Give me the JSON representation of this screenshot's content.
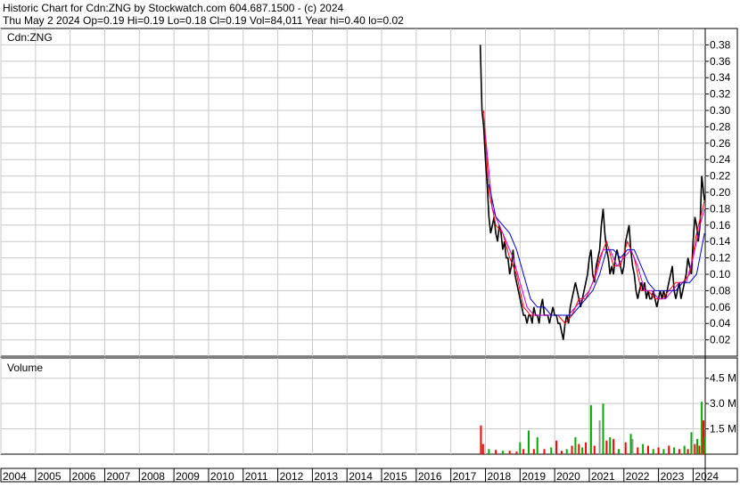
{
  "header": {
    "line1": "Historic Chart for Cdn:ZNG by Stockwatch.com 604.687.1500 - (c) 2024",
    "line2": "Thu May  2 2024  Op=0.19  Hi=0.19  Lo=0.18  Cl=0.19  Vol=84,011  Year hi=0.40  lo=0.02"
  },
  "chart_data": [
    {
      "type": "line",
      "label": "Cdn:ZNG",
      "y_ticks": [
        "0.38",
        "0.36",
        "0.34",
        "0.32",
        "0.30",
        "0.28",
        "0.26",
        "0.24",
        "0.22",
        "0.20",
        "0.18",
        "0.16",
        "0.14",
        "0.12",
        "0.10",
        "0.08",
        "0.06",
        "0.04",
        "0.02"
      ],
      "ylim": [
        0.0,
        0.4
      ],
      "x_ticks": [
        "2004",
        "2005",
        "2006",
        "2007",
        "2008",
        "2009",
        "2010",
        "2011",
        "2012",
        "2013",
        "2014",
        "2015",
        "2016",
        "2017",
        "2018",
        "2019",
        "2020",
        "2021",
        "2022",
        "2023",
        "2024"
      ],
      "xlim": [
        2004.0,
        2024.35
      ],
      "grid": true,
      "series": [
        {
          "key": "price",
          "color": "#000000",
          "x": [
            2017.85,
            2017.9,
            2017.95,
            2018.0,
            2018.05,
            2018.1,
            2018.15,
            2018.2,
            2018.25,
            2018.3,
            2018.35,
            2018.4,
            2018.45,
            2018.5,
            2018.55,
            2018.6,
            2018.65,
            2018.7,
            2018.75,
            2018.8,
            2018.85,
            2018.9,
            2018.95,
            2019.0,
            2019.05,
            2019.1,
            2019.15,
            2019.2,
            2019.25,
            2019.3,
            2019.35,
            2019.4,
            2019.45,
            2019.5,
            2019.55,
            2019.6,
            2019.65,
            2019.7,
            2019.75,
            2019.8,
            2019.85,
            2019.9,
            2019.95,
            2020.0,
            2020.05,
            2020.1,
            2020.15,
            2020.2,
            2020.25,
            2020.3,
            2020.35,
            2020.4,
            2020.45,
            2020.5,
            2020.55,
            2020.6,
            2020.65,
            2020.7,
            2020.75,
            2020.8,
            2020.85,
            2020.9,
            2020.95,
            2021.0,
            2021.05,
            2021.1,
            2021.15,
            2021.2,
            2021.25,
            2021.3,
            2021.35,
            2021.4,
            2021.45,
            2021.5,
            2021.55,
            2021.6,
            2021.65,
            2021.7,
            2021.75,
            2021.8,
            2021.85,
            2021.9,
            2021.95,
            2022.0,
            2022.05,
            2022.1,
            2022.15,
            2022.2,
            2022.25,
            2022.3,
            2022.35,
            2022.4,
            2022.45,
            2022.5,
            2022.55,
            2022.6,
            2022.65,
            2022.7,
            2022.75,
            2022.8,
            2022.85,
            2022.9,
            2022.95,
            2023.0,
            2023.05,
            2023.1,
            2023.15,
            2023.2,
            2023.25,
            2023.3,
            2023.35,
            2023.4,
            2023.45,
            2023.5,
            2023.55,
            2023.6,
            2023.65,
            2023.7,
            2023.75,
            2023.8,
            2023.85,
            2023.9,
            2023.95,
            2024.0,
            2024.05,
            2024.1,
            2024.15,
            2024.2,
            2024.25,
            2024.3,
            2024.33
          ],
          "y": [
            0.38,
            0.3,
            0.28,
            0.24,
            0.21,
            0.17,
            0.15,
            0.16,
            0.17,
            0.15,
            0.14,
            0.16,
            0.15,
            0.13,
            0.14,
            0.12,
            0.12,
            0.1,
            0.11,
            0.13,
            0.1,
            0.09,
            0.08,
            0.07,
            0.06,
            0.05,
            0.05,
            0.04,
            0.05,
            0.05,
            0.04,
            0.06,
            0.05,
            0.05,
            0.04,
            0.06,
            0.07,
            0.05,
            0.05,
            0.05,
            0.04,
            0.05,
            0.06,
            0.05,
            0.05,
            0.04,
            0.04,
            0.03,
            0.02,
            0.04,
            0.05,
            0.04,
            0.06,
            0.07,
            0.08,
            0.09,
            0.08,
            0.07,
            0.06,
            0.07,
            0.08,
            0.09,
            0.1,
            0.12,
            0.13,
            0.1,
            0.09,
            0.11,
            0.12,
            0.13,
            0.16,
            0.18,
            0.15,
            0.13,
            0.12,
            0.1,
            0.11,
            0.1,
            0.12,
            0.13,
            0.12,
            0.11,
            0.1,
            0.11,
            0.14,
            0.15,
            0.16,
            0.13,
            0.11,
            0.1,
            0.08,
            0.07,
            0.08,
            0.09,
            0.08,
            0.09,
            0.07,
            0.08,
            0.07,
            0.07,
            0.08,
            0.07,
            0.06,
            0.07,
            0.08,
            0.07,
            0.08,
            0.07,
            0.08,
            0.09,
            0.1,
            0.11,
            0.08,
            0.07,
            0.08,
            0.09,
            0.07,
            0.08,
            0.09,
            0.1,
            0.12,
            0.11,
            0.1,
            0.14,
            0.17,
            0.16,
            0.14,
            0.16,
            0.22,
            0.2,
            0.19
          ]
        },
        {
          "key": "ma_short",
          "color": "#ff0000",
          "x": [
            2017.95,
            2018.1,
            2018.3,
            2018.5,
            2018.7,
            2018.9,
            2019.1,
            2019.3,
            2019.5,
            2019.7,
            2019.9,
            2020.1,
            2020.3,
            2020.5,
            2020.7,
            2020.9,
            2021.1,
            2021.3,
            2021.5,
            2021.7,
            2021.9,
            2022.1,
            2022.3,
            2022.5,
            2022.7,
            2022.9,
            2023.1,
            2023.3,
            2023.5,
            2023.7,
            2023.9,
            2024.1,
            2024.33
          ],
          "y": [
            0.3,
            0.2,
            0.16,
            0.15,
            0.12,
            0.1,
            0.06,
            0.05,
            0.05,
            0.05,
            0.05,
            0.05,
            0.04,
            0.05,
            0.07,
            0.07,
            0.09,
            0.12,
            0.14,
            0.11,
            0.11,
            0.14,
            0.12,
            0.08,
            0.08,
            0.07,
            0.07,
            0.08,
            0.09,
            0.09,
            0.1,
            0.15,
            0.19
          ]
        },
        {
          "key": "ma_mid",
          "color": "#cc00cc",
          "x": [
            2018.0,
            2018.2,
            2018.4,
            2018.6,
            2018.8,
            2019.0,
            2019.2,
            2019.4,
            2019.6,
            2019.8,
            2020.0,
            2020.2,
            2020.4,
            2020.6,
            2020.8,
            2021.0,
            2021.2,
            2021.4,
            2021.6,
            2021.8,
            2022.0,
            2022.2,
            2022.4,
            2022.6,
            2022.8,
            2023.0,
            2023.2,
            2023.4,
            2023.6,
            2023.8,
            2024.0,
            2024.2,
            2024.33
          ],
          "y": [
            0.27,
            0.18,
            0.16,
            0.14,
            0.12,
            0.09,
            0.06,
            0.05,
            0.05,
            0.05,
            0.05,
            0.05,
            0.05,
            0.06,
            0.07,
            0.08,
            0.1,
            0.13,
            0.13,
            0.11,
            0.12,
            0.13,
            0.11,
            0.08,
            0.08,
            0.07,
            0.07,
            0.08,
            0.09,
            0.09,
            0.12,
            0.16,
            0.18
          ]
        },
        {
          "key": "ma_long",
          "color": "#0000cc",
          "x": [
            2018.1,
            2018.3,
            2018.5,
            2018.7,
            2018.9,
            2019.1,
            2019.3,
            2019.5,
            2019.7,
            2019.9,
            2020.1,
            2020.3,
            2020.5,
            2020.7,
            2020.9,
            2021.1,
            2021.3,
            2021.5,
            2021.7,
            2021.9,
            2022.1,
            2022.3,
            2022.5,
            2022.7,
            2022.9,
            2023.1,
            2023.3,
            2023.5,
            2023.7,
            2023.9,
            2024.1,
            2024.33
          ],
          "y": [
            0.21,
            0.17,
            0.16,
            0.15,
            0.13,
            0.1,
            0.07,
            0.06,
            0.06,
            0.05,
            0.05,
            0.05,
            0.05,
            0.06,
            0.07,
            0.08,
            0.1,
            0.13,
            0.13,
            0.12,
            0.13,
            0.13,
            0.11,
            0.09,
            0.08,
            0.08,
            0.08,
            0.08,
            0.09,
            0.09,
            0.1,
            0.15
          ]
        }
      ]
    },
    {
      "type": "bar",
      "label": "Volume",
      "y_ticks": [
        "4.5 M",
        "3.0 M",
        "1.5 M"
      ],
      "ylim": [
        0,
        5.7
      ],
      "y_tick_values": [
        4.5,
        3.0,
        1.5
      ],
      "colors": {
        "up": "#00aa00",
        "down": "#ff0000",
        "flat": "#999999"
      },
      "bars": [
        {
          "x": 2017.87,
          "v": 1.7,
          "c": "down"
        },
        {
          "x": 2017.93,
          "v": 0.6,
          "c": "down"
        },
        {
          "x": 2018.1,
          "v": 0.3,
          "c": "up"
        },
        {
          "x": 2018.3,
          "v": 0.25,
          "c": "down"
        },
        {
          "x": 2018.5,
          "v": 0.2,
          "c": "up"
        },
        {
          "x": 2018.7,
          "v": 0.2,
          "c": "down"
        },
        {
          "x": 2018.9,
          "v": 0.15,
          "c": "down"
        },
        {
          "x": 2019.0,
          "v": 0.7,
          "c": "up"
        },
        {
          "x": 2019.1,
          "v": 0.3,
          "c": "down"
        },
        {
          "x": 2019.25,
          "v": 1.4,
          "c": "up"
        },
        {
          "x": 2019.4,
          "v": 0.3,
          "c": "down"
        },
        {
          "x": 2019.5,
          "v": 1.0,
          "c": "up"
        },
        {
          "x": 2019.7,
          "v": 0.3,
          "c": "down"
        },
        {
          "x": 2019.9,
          "v": 0.4,
          "c": "up"
        },
        {
          "x": 2020.05,
          "v": 0.8,
          "c": "down"
        },
        {
          "x": 2020.2,
          "v": 0.2,
          "c": "down"
        },
        {
          "x": 2020.35,
          "v": 0.3,
          "c": "up"
        },
        {
          "x": 2020.5,
          "v": 0.5,
          "c": "down"
        },
        {
          "x": 2020.6,
          "v": 1.0,
          "c": "up"
        },
        {
          "x": 2020.7,
          "v": 0.6,
          "c": "down"
        },
        {
          "x": 2020.8,
          "v": 0.4,
          "c": "up"
        },
        {
          "x": 2020.9,
          "v": 0.7,
          "c": "down"
        },
        {
          "x": 2021.05,
          "v": 2.9,
          "c": "up"
        },
        {
          "x": 2021.15,
          "v": 0.5,
          "c": "down"
        },
        {
          "x": 2021.3,
          "v": 2.0,
          "c": "flat"
        },
        {
          "x": 2021.4,
          "v": 3.0,
          "c": "up"
        },
        {
          "x": 2021.5,
          "v": 0.8,
          "c": "down"
        },
        {
          "x": 2021.6,
          "v": 1.0,
          "c": "up"
        },
        {
          "x": 2021.7,
          "v": 0.9,
          "c": "down"
        },
        {
          "x": 2021.85,
          "v": 0.3,
          "c": "up"
        },
        {
          "x": 2022.05,
          "v": 0.7,
          "c": "down"
        },
        {
          "x": 2022.2,
          "v": 1.2,
          "c": "up"
        },
        {
          "x": 2022.25,
          "v": 0.9,
          "c": "flat"
        },
        {
          "x": 2022.4,
          "v": 0.4,
          "c": "down"
        },
        {
          "x": 2022.55,
          "v": 0.6,
          "c": "up"
        },
        {
          "x": 2022.7,
          "v": 0.5,
          "c": "down"
        },
        {
          "x": 2022.85,
          "v": 0.3,
          "c": "up"
        },
        {
          "x": 2023.0,
          "v": 0.4,
          "c": "down"
        },
        {
          "x": 2023.15,
          "v": 0.3,
          "c": "up"
        },
        {
          "x": 2023.3,
          "v": 0.5,
          "c": "down"
        },
        {
          "x": 2023.45,
          "v": 0.4,
          "c": "up"
        },
        {
          "x": 2023.6,
          "v": 0.3,
          "c": "down"
        },
        {
          "x": 2023.75,
          "v": 0.5,
          "c": "up"
        },
        {
          "x": 2023.85,
          "v": 0.3,
          "c": "down"
        },
        {
          "x": 2023.95,
          "v": 1.3,
          "c": "up"
        },
        {
          "x": 2024.05,
          "v": 0.6,
          "c": "down"
        },
        {
          "x": 2024.12,
          "v": 0.9,
          "c": "up"
        },
        {
          "x": 2024.18,
          "v": 0.5,
          "c": "down"
        },
        {
          "x": 2024.25,
          "v": 3.1,
          "c": "up"
        },
        {
          "x": 2024.3,
          "v": 2.0,
          "c": "down"
        },
        {
          "x": 2024.33,
          "v": 1.0,
          "c": "up"
        }
      ]
    }
  ]
}
